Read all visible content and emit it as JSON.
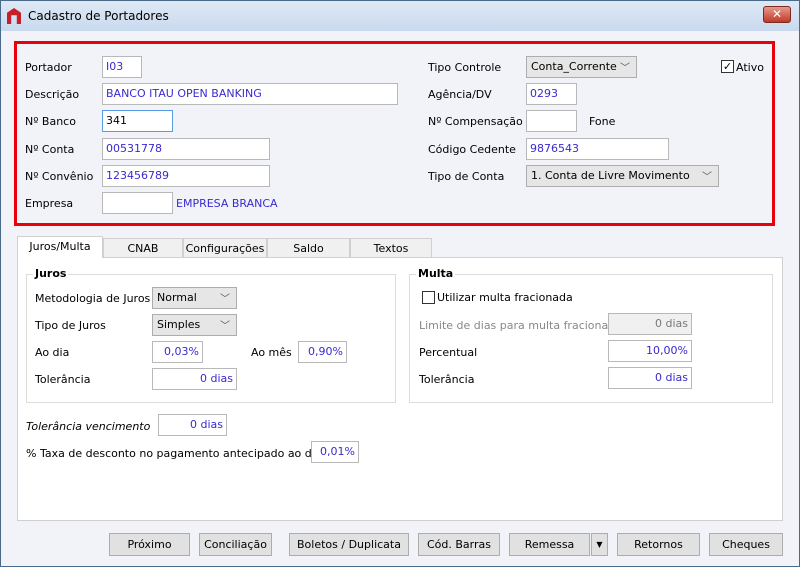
{
  "window": {
    "title": "Cadastro de Portadores",
    "close": "✕"
  },
  "header": {
    "portador": {
      "label": "Portador",
      "value": "I03"
    },
    "descricao": {
      "label": "Descrição",
      "value": "BANCO ITAU OPEN BANKING"
    },
    "banco": {
      "label": "Nº Banco",
      "value": "341"
    },
    "conta": {
      "label": "Nº Conta",
      "value": "00531778"
    },
    "convenio": {
      "label": "Nº Convênio",
      "value": "123456789"
    },
    "empresa": {
      "label": "Empresa",
      "value": "",
      "name": "EMPRESA BRANCA"
    },
    "tipo_controle": {
      "label": "Tipo Controle",
      "value": "Conta_Corrente"
    },
    "ativo": {
      "label": "Ativo",
      "checked": true
    },
    "agencia": {
      "label": "Agência/DV",
      "value": "0293"
    },
    "compensacao": {
      "label": "Nº Compensação",
      "value": "",
      "fone": "Fone"
    },
    "cedente": {
      "label": "Código Cedente",
      "value": "9876543"
    },
    "tipo_conta": {
      "label": "Tipo de Conta",
      "value": "1. Conta de Livre Movimento"
    }
  },
  "tabs": [
    {
      "label": "Juros/Multa",
      "selected": true
    },
    {
      "label": "CNAB"
    },
    {
      "label": "Configurações"
    },
    {
      "label": "Saldo"
    },
    {
      "label": "Textos"
    }
  ],
  "juros": {
    "title": "Juros",
    "metodologia": {
      "label": "Metodologia de Juros",
      "value": "Normal"
    },
    "tipo": {
      "label": "Tipo de Juros",
      "value": "Simples"
    },
    "ao_dia": {
      "label": "Ao dia",
      "value": "0,03%"
    },
    "ao_mes": {
      "label": "Ao mês",
      "value": "0,90%"
    },
    "tolerancia": {
      "label": "Tolerância",
      "value": "0 dias"
    }
  },
  "multa": {
    "title": "Multa",
    "fracionada": {
      "label": "Utilizar multa fracionada",
      "checked": false
    },
    "limite": {
      "label": "Limite de dias para multa fracionada",
      "value": "0 dias"
    },
    "percentual": {
      "label": "Percentual",
      "value": "10,00%"
    },
    "tolerancia": {
      "label": "Tolerância",
      "value": "0 dias"
    }
  },
  "tolerancia_vencimento": {
    "label": "Tolerância vencimento",
    "value": "0 dias"
  },
  "taxa_desconto": {
    "label": "% Taxa de desconto no pagamento antecipado ao dia",
    "value": "0,01%"
  },
  "buttons": [
    "Próximo",
    "Conciliação",
    "Boletos / Duplicata",
    "Cód. Barras",
    "Remessa",
    "Retornos",
    "Cheques"
  ],
  "colors": {
    "highlight": "#e8000b",
    "value_text": "#3a2ad0"
  }
}
